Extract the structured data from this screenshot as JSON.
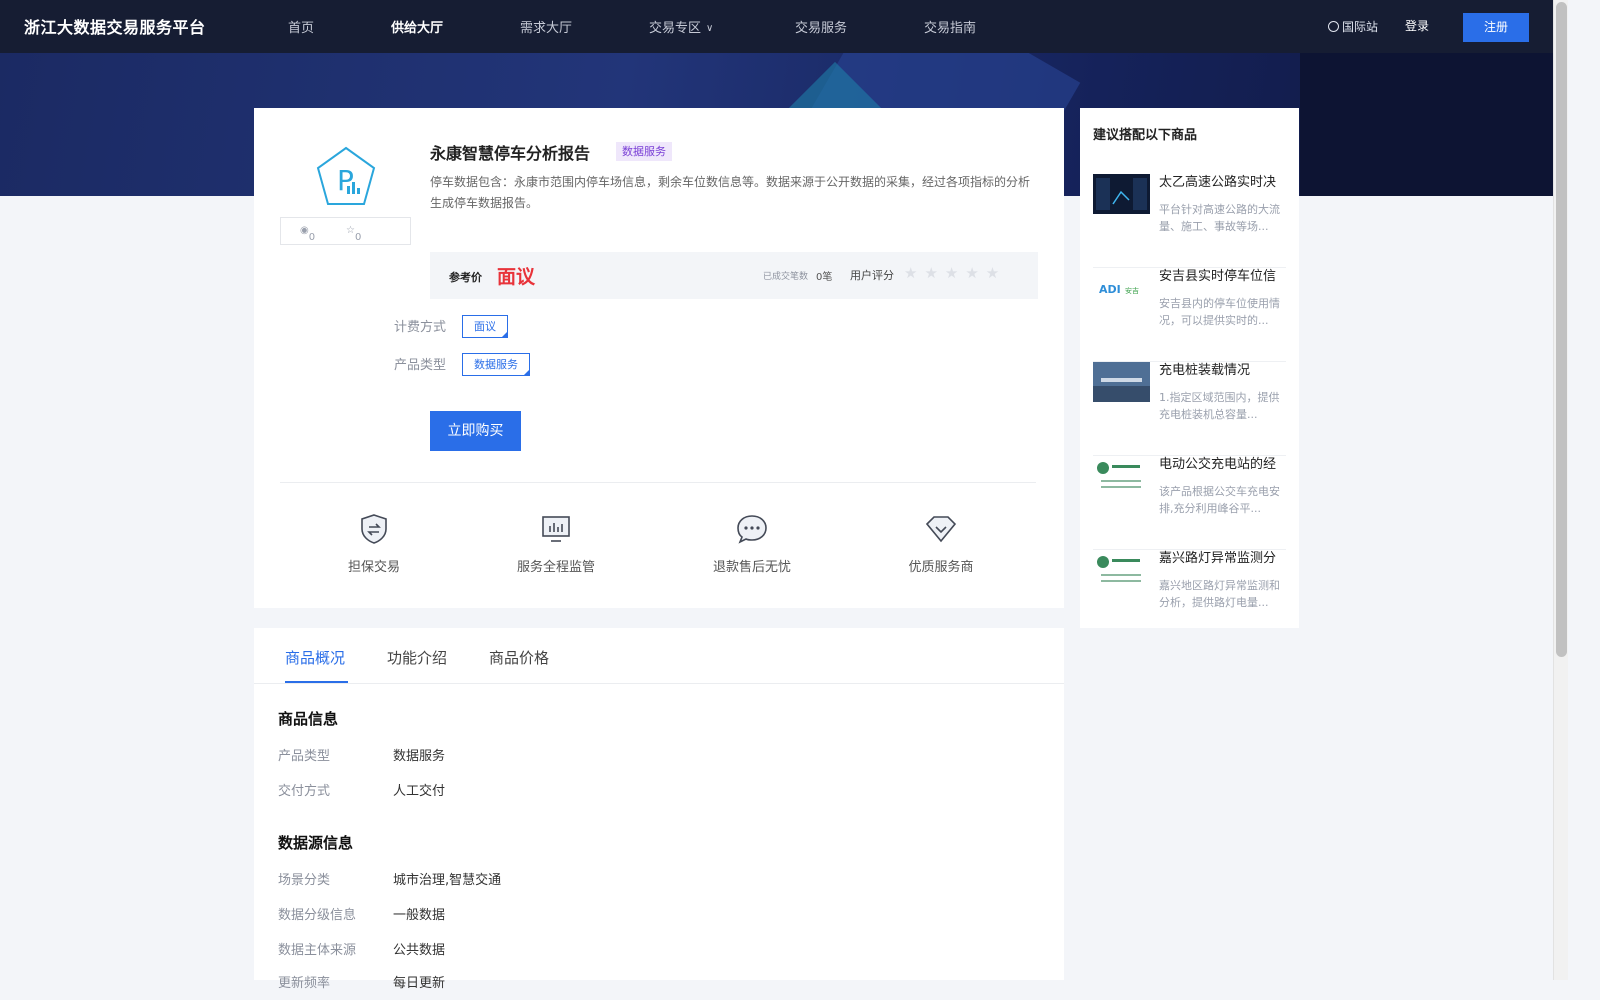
{
  "brand": "浙江大数据交易服务平台",
  "nav": {
    "items": [
      {
        "label": "首页",
        "active": false
      },
      {
        "label": "供给大厅",
        "active": true
      },
      {
        "label": "需求大厅",
        "active": false
      },
      {
        "label": "交易专区",
        "active": false,
        "dropdown": true
      },
      {
        "label": "交易服务",
        "active": false
      },
      {
        "label": "交易指南",
        "active": false
      }
    ],
    "intl": "国际站",
    "login": "登录",
    "register": "注册"
  },
  "product": {
    "title": "永康智慧停车分析报告",
    "tag": "数据服务",
    "description": "停车数据包含：永康市范围内停车场信息，剩余车位数信息等。数据来源于公开数据的采集，经过各项指标的分析生成停车数据报告。",
    "views": "0",
    "favorites": "0",
    "price_label": "参考价",
    "price": "面议",
    "deals_label": "已成交笔数",
    "deals": "0笔",
    "rating_label": "用户评分",
    "rating": 0,
    "billing_label": "计费方式",
    "billing_option": "面议",
    "type_label": "产品类型",
    "type_option": "数据服务",
    "buy_button": "立即购买",
    "features": [
      "担保交易",
      "服务全程监管",
      "退款售后无忧",
      "优质服务商"
    ]
  },
  "suggest": {
    "title": "建议搭配以下商品",
    "items": [
      {
        "name": "太乙高速公路实时决",
        "desc": "平台针对高速公路的大流量、施工、事故等场..."
      },
      {
        "name": "安吉县实时停车位信",
        "desc": "安吉县内的停车位使用情况，可以提供实时的..."
      },
      {
        "name": "充电桩装载情况",
        "desc": "1.指定区域范围内，提供充电桩装机总容量..."
      },
      {
        "name": "电动公交充电站的经",
        "desc": "该产品根据公交车充电安排,充分利用峰谷平..."
      },
      {
        "name": "嘉兴路灯异常监测分",
        "desc": "嘉兴地区路灯异常监测和分析，提供路灯电量..."
      }
    ]
  },
  "details": {
    "tabs": [
      "商品概况",
      "功能介绍",
      "商品价格"
    ],
    "section1_title": "商品信息",
    "section1_rows": [
      {
        "label": "产品类型",
        "value": "数据服务"
      },
      {
        "label": "交付方式",
        "value": "人工交付"
      }
    ],
    "section2_title": "数据源信息",
    "section2_rows": [
      {
        "label": "场景分类",
        "value": "城市治理,智慧交通"
      },
      {
        "label": "数据分级信息",
        "value": "一般数据"
      },
      {
        "label": "数据主体来源",
        "value": "公共数据"
      },
      {
        "label": "更新频率",
        "value": "每日更新"
      }
    ]
  },
  "colors": {
    "accent": "#2a6ee8",
    "price": "#e8333a",
    "nav_bg": "#161d33"
  }
}
